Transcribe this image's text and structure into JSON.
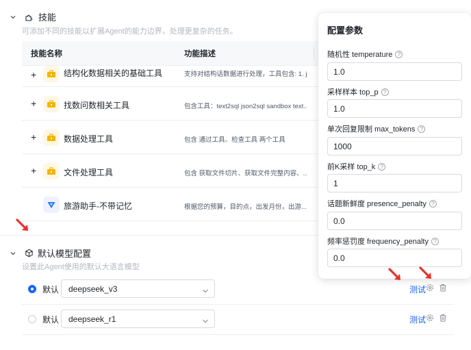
{
  "skills_section": {
    "title": "技能",
    "subtitle": "可添加不同的技能以扩展Agent的能力边界，处理更复杂的任务。",
    "columns": [
      "技能名称",
      "功能描述"
    ],
    "rows": [
      {
        "name": "结构化数据相关的基础工具",
        "desc": "支持对结构话数据进行处理，工具包含: 1. j...",
        "expandable": true
      },
      {
        "name": "找数问数相关工具",
        "desc": "包含工具：text2sql json2sql sandbox text...",
        "expandable": true
      },
      {
        "name": "数据处理工具",
        "desc": "包含 通过工具、检查工具 两个工具",
        "expandable": true
      },
      {
        "name": "文件处理工具",
        "desc": "包含 获取文件切片、获取文件完整内容、...",
        "expandable": true
      },
      {
        "name": "旅游助手-不带记忆",
        "desc": "根据您的预算，目的点，出发月份，出游...",
        "expandable": false
      }
    ]
  },
  "model_section": {
    "title": "默认模型配置",
    "subtitle": "设置此Agent使用的默认大语言模型",
    "models": [
      {
        "label": "默认",
        "value": "deepseek_v3",
        "selected": true,
        "test_label": "测试"
      },
      {
        "label": "默认",
        "value": "deepseek_r1",
        "selected": false,
        "test_label": "测试"
      }
    ]
  },
  "config_panel": {
    "title": "配置参数",
    "params": [
      {
        "label": "随机性 temperature",
        "value": "1.0"
      },
      {
        "label": "采样样本 top_p",
        "value": "1.0"
      },
      {
        "label": "单次回复限制 max_tokens",
        "value": "1000"
      },
      {
        "label": "前K采样 top_k",
        "value": "1"
      },
      {
        "label": "话题新鲜度 presence_penalty",
        "value": "0.0"
      },
      {
        "label": "频率惩罚度 frequency_penalty",
        "value": "0.0"
      }
    ]
  },
  "colors": {
    "accent": "#1664ff",
    "arrow": "#e5322d"
  }
}
